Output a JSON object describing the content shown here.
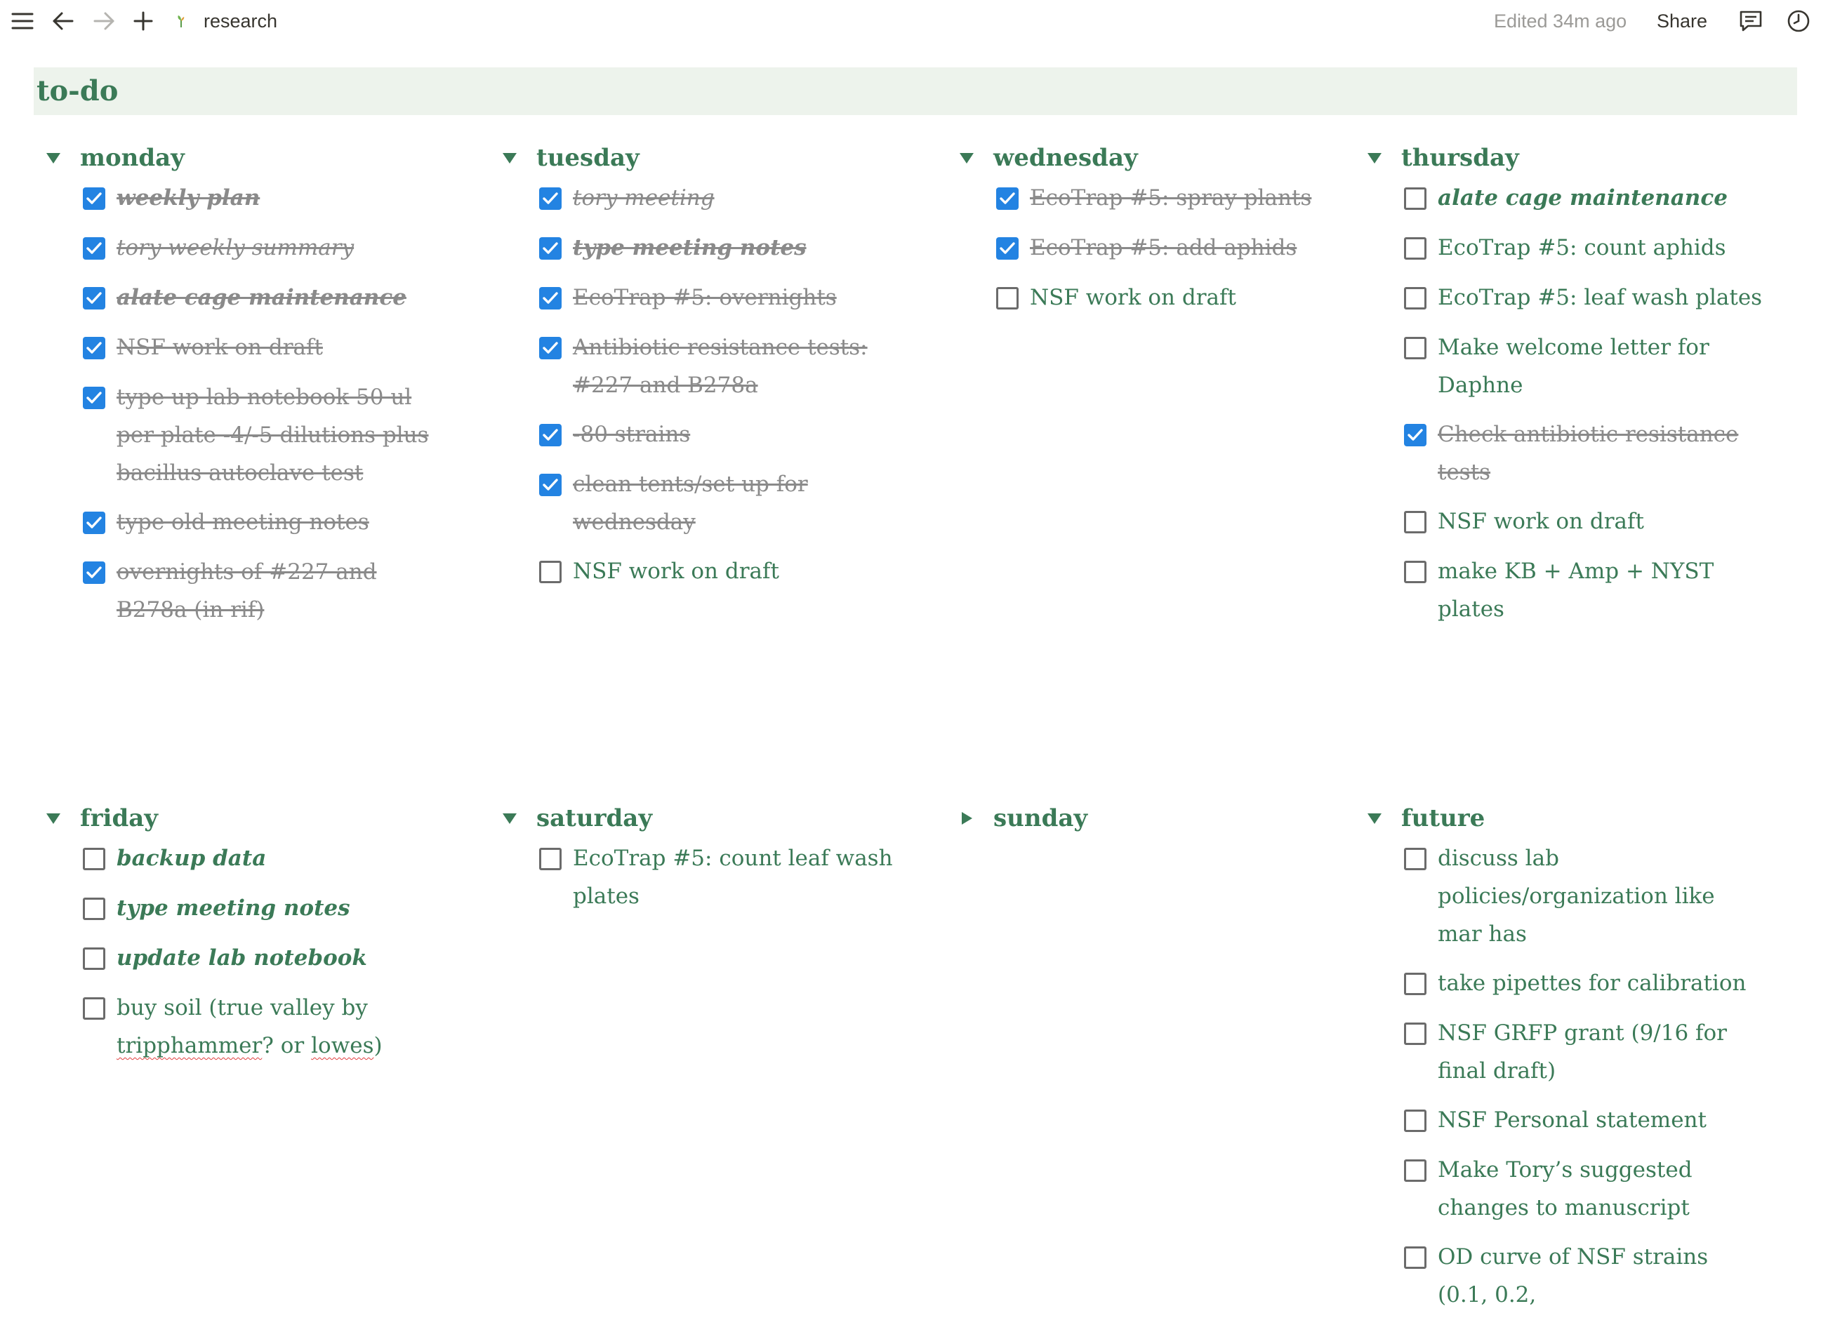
{
  "topbar": {
    "menu_icon": "hamburger-menu-icon",
    "back_icon": "arrow-left-icon",
    "forward_icon": "arrow-right-icon",
    "new_icon": "plus-icon",
    "page_icon": "sprout-icon",
    "breadcrumb": "research",
    "edited": "Edited 34m ago",
    "share": "Share",
    "comments_icon": "comment-icon",
    "updates_icon": "clock-icon"
  },
  "title": "to-do",
  "accent": "#3b7a57",
  "checkbox_color": "#2383e2",
  "columns": [
    {
      "label": "monday",
      "expanded": true,
      "items": [
        {
          "text": "weekly plan",
          "checked": true,
          "style": "bold-italic"
        },
        {
          "text": "tory weekly summary",
          "checked": true,
          "style": "italic"
        },
        {
          "text": "alate cage maintenance",
          "checked": true,
          "style": "bold-italic"
        },
        {
          "text": "NSF work on draft",
          "checked": true,
          "style": "normal"
        },
        {
          "text": "type up lab notebook 50 ul per plate -4/-5 dilutions plus bacillus autoclave test",
          "checked": true,
          "style": "normal"
        },
        {
          "text": "type old meeting notes",
          "checked": true,
          "style": "normal"
        },
        {
          "text": "overnights of #227 and B278a (in rif)",
          "checked": true,
          "style": "normal"
        }
      ]
    },
    {
      "label": "tuesday",
      "expanded": true,
      "items": [
        {
          "text": "tory meeting",
          "checked": true,
          "style": "italic"
        },
        {
          "text": "type meeting notes",
          "checked": true,
          "style": "bold-italic"
        },
        {
          "text": "EcoTrap #5: overnights",
          "checked": true,
          "style": "normal"
        },
        {
          "text": "Antibiotic resistance tests: #227 and B278a",
          "checked": true,
          "style": "normal"
        },
        {
          "text": "-80 strains",
          "checked": true,
          "style": "normal"
        },
        {
          "text": "clean tents/set up for wednesday",
          "checked": true,
          "style": "normal"
        },
        {
          "text": "NSF work on draft",
          "checked": false,
          "style": "normal"
        }
      ]
    },
    {
      "label": "wednesday",
      "expanded": true,
      "items": [
        {
          "text": "EcoTrap #5: spray plants",
          "checked": true,
          "style": "normal"
        },
        {
          "text": "EcoTrap #5: add aphids",
          "checked": true,
          "style": "normal"
        },
        {
          "text": "NSF work on draft",
          "checked": false,
          "style": "normal"
        }
      ]
    },
    {
      "label": "thursday",
      "expanded": true,
      "items": [
        {
          "text": "alate cage maintenance",
          "checked": false,
          "style": "bold-italic"
        },
        {
          "text": "EcoTrap #5: count aphids",
          "checked": false,
          "style": "normal"
        },
        {
          "text": "EcoTrap #5: leaf wash plates",
          "checked": false,
          "style": "normal"
        },
        {
          "text": "Make welcome letter for Daphne",
          "checked": false,
          "style": "normal"
        },
        {
          "text": "Check antibiotic resistance tests",
          "checked": true,
          "style": "normal"
        },
        {
          "text": "NSF work on draft",
          "checked": false,
          "style": "normal"
        },
        {
          "text": "make KB + Amp + NYST plates",
          "checked": false,
          "style": "normal"
        }
      ]
    },
    {
      "label": "friday",
      "expanded": true,
      "items": [
        {
          "text": "backup data",
          "checked": false,
          "style": "bold-italic"
        },
        {
          "text": "type meeting notes",
          "checked": false,
          "style": "bold-italic"
        },
        {
          "text": "update lab notebook",
          "checked": false,
          "style": "bold-italic"
        },
        {
          "text": "buy soil (true valley by ",
          "checked": false,
          "style": "normal",
          "extra": [
            "tripphammer",
            "? or ",
            "lowes",
            ")"
          ]
        }
      ]
    },
    {
      "label": "saturday",
      "expanded": true,
      "items": [
        {
          "text": "EcoTrap #5: count leaf wash plates",
          "checked": false,
          "style": "normal"
        }
      ]
    },
    {
      "label": "sunday",
      "expanded": false,
      "items": []
    },
    {
      "label": "future",
      "expanded": true,
      "items": [
        {
          "text": "discuss lab policies/organization like mar has",
          "checked": false,
          "style": "normal"
        },
        {
          "text": "take pipettes for calibration",
          "checked": false,
          "style": "normal"
        },
        {
          "text": "NSF GRFP grant (9/16 for final draft)",
          "checked": false,
          "style": "normal"
        },
        {
          "text": "NSF Personal statement",
          "checked": false,
          "style": "normal"
        },
        {
          "text": "Make Tory’s suggested changes to manuscript",
          "checked": false,
          "style": "normal"
        },
        {
          "text": "OD curve of NSF strains (0.1, 0.2,",
          "checked": false,
          "style": "normal"
        }
      ]
    }
  ]
}
